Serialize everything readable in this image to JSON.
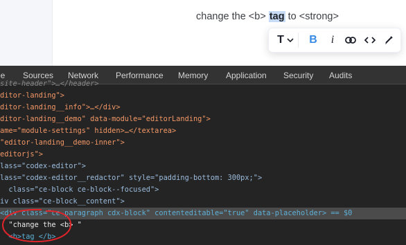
{
  "editor": {
    "before_text": "change the <b> ",
    "selected_word": "tag",
    "after_text": " to <strong>",
    "toolbar": {
      "text_icon": "T",
      "bold_icon": "B",
      "italic_icon": "i"
    }
  },
  "devtools": {
    "tabs": [
      "le",
      "Sources",
      "Network",
      "Performance",
      "Memory",
      "Application",
      "Security",
      "Audits"
    ],
    "lines": [
      {
        "tag_open": "",
        "text": "site-header\">…</header>"
      },
      {
        "tag_open": "",
        "text": "ditor-landing\">"
      },
      {
        "tag_open": "",
        "text": "ditor-landing__info\">…</div>"
      },
      {
        "tag_open": "",
        "text": "ditor-landing__demo\" data-module=\"editorLanding\">"
      },
      {
        "tag_open": "",
        "text": "ame=\"module-settings\" hidden>…</textarea>"
      },
      {
        "tag_open": "",
        "text": "\"editor-landing__demo-inner\">"
      },
      {
        "tag_open": "",
        "text": "editorjs\">"
      },
      {
        "tag_open": "",
        "text": "lass=\"codex-editor\">"
      },
      {
        "tag_open": "",
        "text": "lass=\"codex-editor__redactor\" style=\"padding-bottom: 300px;\">"
      },
      {
        "tag_open": "",
        "text": "  class=\"ce-block ce-block--focused\">"
      },
      {
        "tag_open": "",
        "text": "iv class=\"ce-block__content\">"
      },
      {
        "tag_open": "",
        "text": "<div class=\"ce-paragraph cdx-block\" contenteditable=\"true\" data-placeholder> == $0"
      },
      {
        "tag_open": "",
        "text": "  \"change the <b> \""
      },
      {
        "tag_open": "",
        "text": "  <b>tag </b>"
      }
    ]
  },
  "colors": {
    "bold_accent": "#388ae5",
    "selection_bg": "#c7dbf5",
    "devtools_bg": "#242424",
    "tag_color": "#5db0d7",
    "attr_value_color": "#f29766",
    "annotation_circle": "#e0242a"
  }
}
